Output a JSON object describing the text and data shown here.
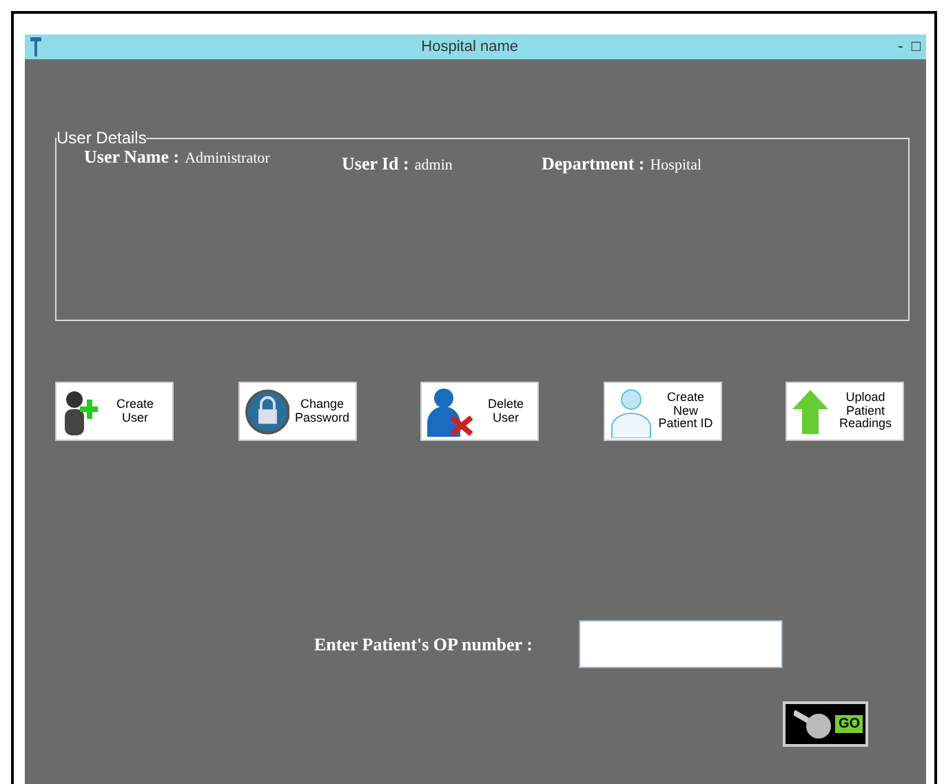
{
  "window": {
    "title": "Hospital name",
    "controls": [
      "-",
      "□"
    ]
  },
  "user_details": {
    "legend": "User Details",
    "fields": [
      {
        "label": "User Name :",
        "value": "Administrator"
      },
      {
        "label": "User Id :",
        "value": "admin"
      },
      {
        "label": "Department :",
        "value": "Hospital"
      }
    ]
  },
  "actions": [
    {
      "kind": "create-user",
      "label": "Create User"
    },
    {
      "kind": "lock",
      "label": "Change Password"
    },
    {
      "kind": "delete-user",
      "label": "Delete User"
    },
    {
      "kind": "patient",
      "label": "Create New Patient ID"
    },
    {
      "kind": "upload",
      "label": "Upload Patient Readings"
    }
  ],
  "op_search": {
    "label": "Enter Patient's OP number :",
    "go": "GO"
  }
}
